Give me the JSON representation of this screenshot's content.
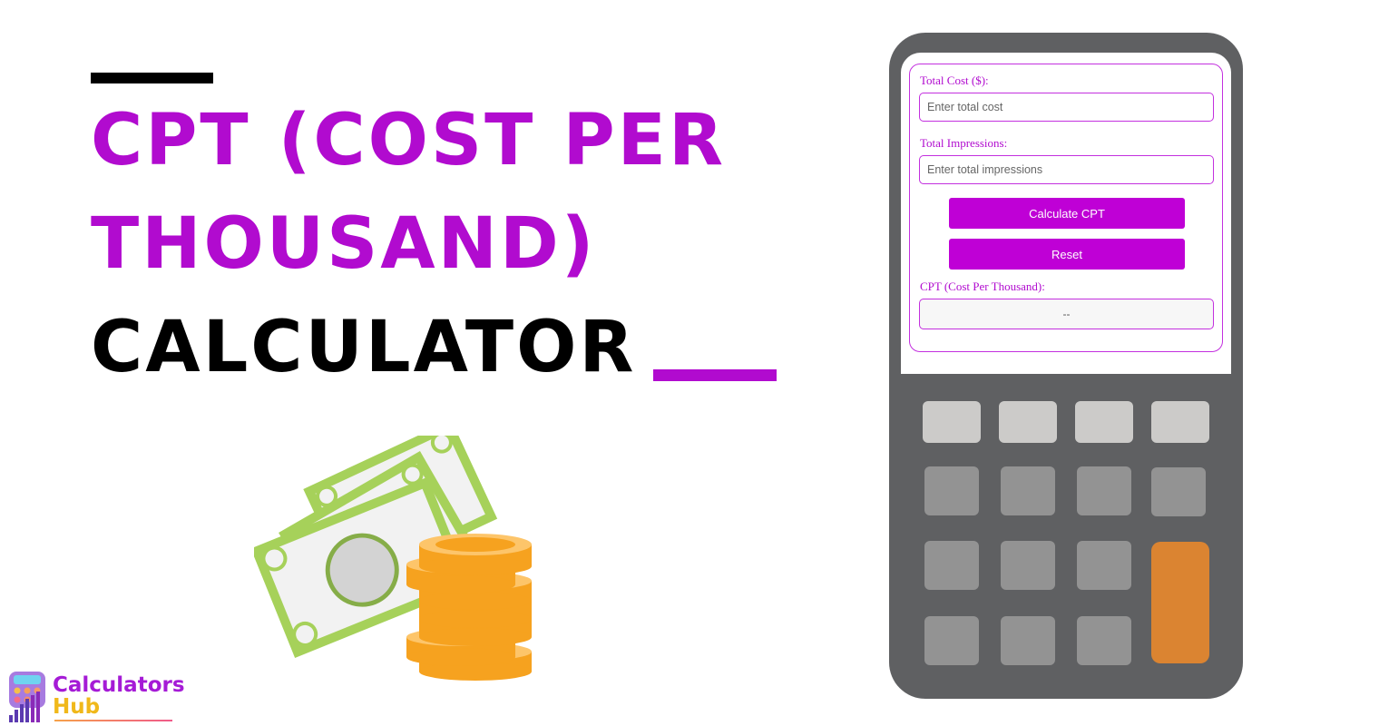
{
  "headline": {
    "line1": "CPT (Cost Per",
    "line2": "Thousand)",
    "line3": "Calculator"
  },
  "colors": {
    "accent": "#b10bcf",
    "button": "#bf00d6",
    "calculator_body": "#5f6062",
    "key_light": "#cccbc9",
    "key_dark": "#939393",
    "key_orange": "#db8431"
  },
  "calculator": {
    "total_cost_label": "Total Cost ($):",
    "total_cost_placeholder": "Enter total cost",
    "total_cost_value": "",
    "impressions_label": "Total Impressions:",
    "impressions_placeholder": "Enter total impressions",
    "impressions_value": "",
    "calculate_button": "Calculate CPT",
    "reset_button": "Reset",
    "result_label": "CPT (Cost Per Thousand):",
    "result_value": "--"
  },
  "illustration": {
    "icon": "money-bills-and-coins-icon"
  },
  "logo": {
    "line1": "Calculators",
    "line2": "Hub"
  }
}
